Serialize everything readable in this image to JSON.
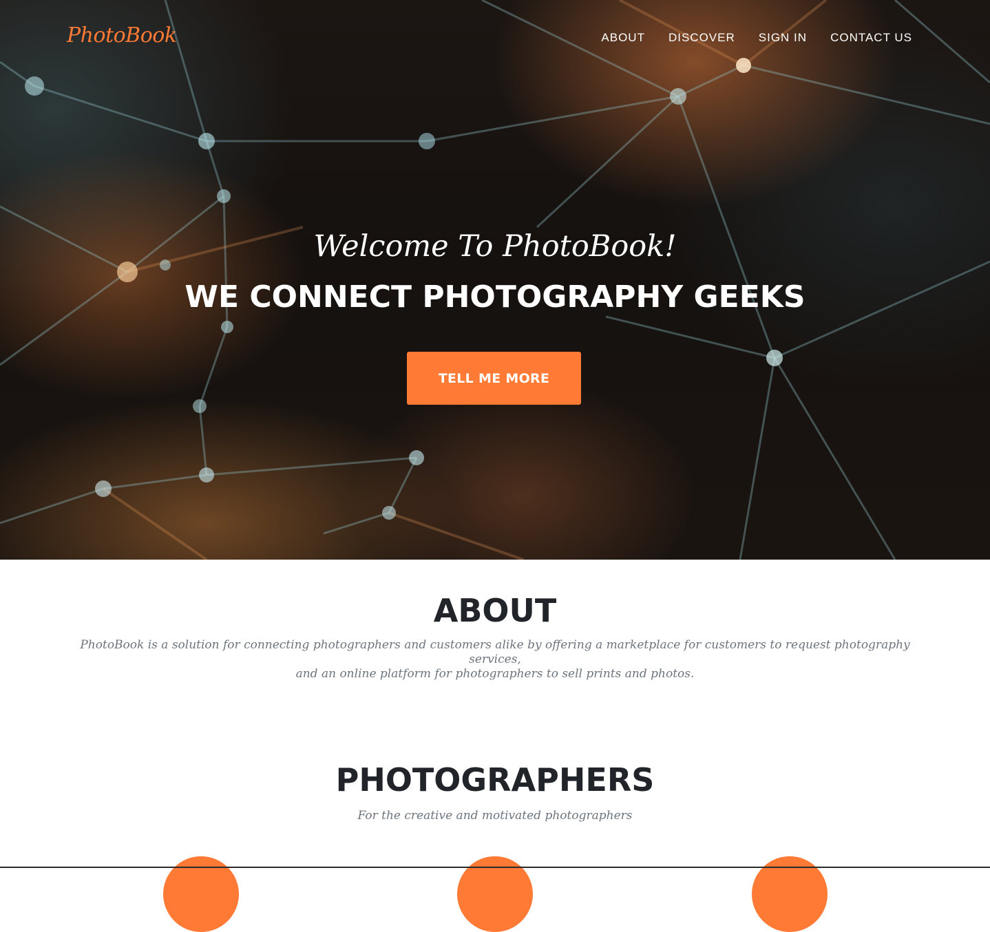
{
  "nav": {
    "brand": "PhotoBook",
    "links": [
      "ABOUT",
      "DISCOVER",
      "SIGN IN",
      "CONTACT US"
    ]
  },
  "hero": {
    "welcome": "Welcome To PhotoBook!",
    "tagline": "WE CONNECT PHOTOGRAPHY GEEKS",
    "cta_label": "TELL ME MORE"
  },
  "about": {
    "title": "ABOUT",
    "text_line1": "PhotoBook is a solution for connecting photographers and customers alike by offering a marketplace for customers to request photography services,",
    "text_line2": "and an online platform for photographers to sell prints and photos."
  },
  "photographers": {
    "title": "PHOTOGRAPHERS",
    "subtitle": "For the creative and motivated photographers"
  },
  "colors": {
    "accent": "#ff7a35",
    "heading": "#212529",
    "muted": "#6c757d"
  }
}
